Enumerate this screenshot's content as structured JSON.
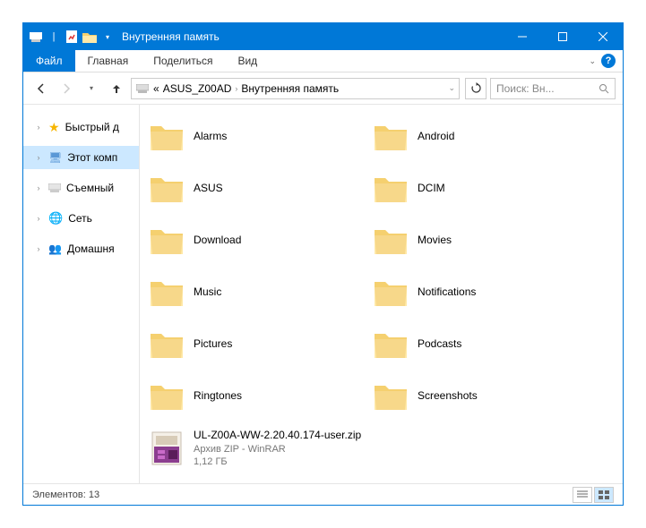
{
  "window": {
    "title": "Внутренняя память"
  },
  "ribbon": {
    "file": "Файл",
    "tabs": [
      "Главная",
      "Поделиться",
      "Вид"
    ]
  },
  "breadcrumb": {
    "parts": [
      "ASUS_Z00AD",
      "Внутренняя память"
    ],
    "prefix": "«"
  },
  "search": {
    "placeholder": "Поиск: Вн..."
  },
  "sidebar": {
    "items": [
      {
        "label": "Быстрый д",
        "icon": "star"
      },
      {
        "label": "Этот комп",
        "icon": "pc",
        "selected": true
      },
      {
        "label": "Съемный",
        "icon": "drive"
      },
      {
        "label": "Сеть",
        "icon": "net"
      },
      {
        "label": "Домашня",
        "icon": "home"
      }
    ]
  },
  "folders": [
    "Alarms",
    "Android",
    "ASUS",
    "DCIM",
    "Download",
    "Movies",
    "Music",
    "Notifications",
    "Pictures",
    "Podcasts",
    "Ringtones",
    "Screenshots"
  ],
  "file": {
    "name": "UL-Z00A-WW-2.20.40.174-user.zip",
    "type": "Архив ZIP - WinRAR",
    "size": "1,12 ГБ"
  },
  "status": {
    "count_label": "Элементов: 13"
  }
}
